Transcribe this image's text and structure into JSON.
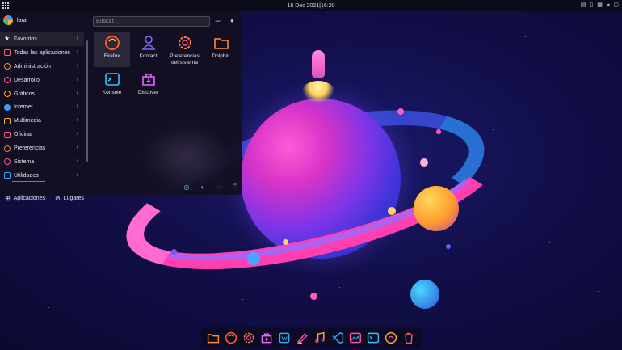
{
  "topbar": {
    "clock": "18 Dec 2021|16:20",
    "tray_icons": [
      "clipboard-icon",
      "device-icon",
      "network-icon",
      "volume-icon",
      "notification-icon"
    ]
  },
  "menu": {
    "user_name": "lara",
    "search": {
      "placeholder": "Buscar..."
    },
    "categories": [
      {
        "label": "Favoritos",
        "icon": "star-icon",
        "color": "#e6e6ee"
      },
      {
        "label": "Todas las aplicaciones",
        "icon": "apps-grid-icon",
        "color": "#ff6a6a"
      },
      {
        "label": "Administración",
        "icon": "gear-icon",
        "color": "#ff8a3c"
      },
      {
        "label": "Desarrollo",
        "icon": "code-icon",
        "color": "#ff4fa0"
      },
      {
        "label": "Gráficos",
        "icon": "graphics-icon",
        "color": "#ffb02e"
      },
      {
        "label": "Internet",
        "icon": "globe-icon",
        "color": "#3aa0ff"
      },
      {
        "label": "Multimedia",
        "icon": "play-icon",
        "color": "#ffb02e"
      },
      {
        "label": "Oficina",
        "icon": "document-icon",
        "color": "#ff5b7a"
      },
      {
        "label": "Preferencias",
        "icon": "settings-icon",
        "color": "#ff7a3c"
      },
      {
        "label": "Sistema",
        "icon": "system-icon",
        "color": "#ff4fa0"
      },
      {
        "label": "Utilidades",
        "icon": "utilities-icon",
        "color": "#3aa0ff"
      }
    ],
    "apps": [
      {
        "label": "Firefox",
        "icon": "firefox-icon",
        "color": "#ff5b2e"
      },
      {
        "label": "Kontact",
        "icon": "contact-icon",
        "color": "#7b6bff"
      },
      {
        "label": "Preferencias del sistema",
        "icon": "settings-icon",
        "color": "#ff7a3c"
      },
      {
        "label": "Dolphin",
        "icon": "folder-icon",
        "color": "#ff8a3c"
      },
      {
        "label": "Konsole",
        "icon": "terminal-icon",
        "color": "#36c6ff"
      },
      {
        "label": "Discover",
        "icon": "discover-icon",
        "color": "#e56bff"
      }
    ],
    "bottom": {
      "applications_label": "Aplicaciones",
      "places_label": "Lugares"
    }
  },
  "dock": [
    {
      "name": "dolphin",
      "icon": "folder-icon",
      "color": "#ff8a3c"
    },
    {
      "name": "firefox",
      "icon": "firefox-icon",
      "color": "#ff5b2e"
    },
    {
      "name": "settings",
      "icon": "settings-icon",
      "color": "#ff7a3c"
    },
    {
      "name": "discover",
      "icon": "discover-icon",
      "color": "#e56bff"
    },
    {
      "name": "writer",
      "icon": "writer-icon",
      "color": "#36a8ff"
    },
    {
      "name": "kate",
      "icon": "pen-icon",
      "color": "#ff4fa0"
    },
    {
      "name": "music",
      "icon": "music-icon",
      "color": "#ffb02e"
    },
    {
      "name": "vscode",
      "icon": "vscode-icon",
      "color": "#36a8ff"
    },
    {
      "name": "image-viewer",
      "icon": "image-icon",
      "color": "#ff4fa0"
    },
    {
      "name": "konsole",
      "icon": "terminal-icon",
      "color": "#36c6ff"
    },
    {
      "name": "store",
      "icon": "bag-icon",
      "color": "#ffb02e"
    },
    {
      "name": "trash",
      "icon": "trash-icon",
      "color": "#ff5b5b"
    }
  ]
}
